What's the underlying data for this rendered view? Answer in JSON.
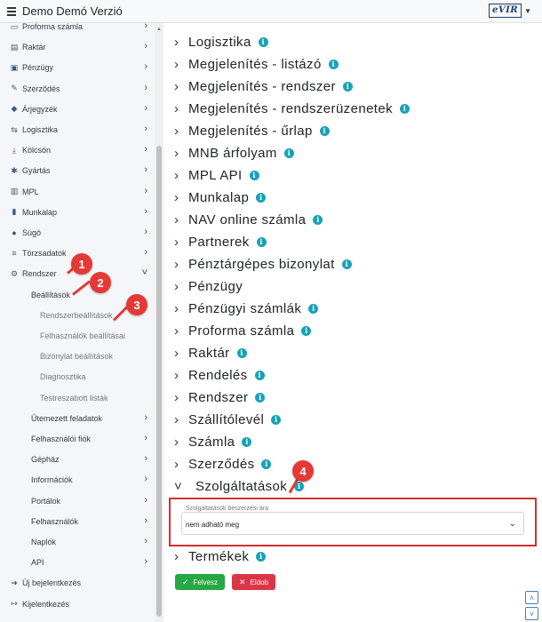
{
  "header": {
    "title": "Demo Demó Verzió",
    "logo_text": "eVIR"
  },
  "sidebar": {
    "items": [
      {
        "label": "Proforma számla",
        "icon": "invoice-icon",
        "chevron": "›"
      },
      {
        "label": "Raktár",
        "icon": "warehouse-icon",
        "chevron": "›"
      },
      {
        "label": "Pénzügy",
        "icon": "money-icon",
        "chevron": "›"
      },
      {
        "label": "Szerződés",
        "icon": "contract-icon",
        "chevron": "›"
      },
      {
        "label": "Árjegyzék",
        "icon": "tag-icon",
        "chevron": "›"
      },
      {
        "label": "Logisztika",
        "icon": "logistics-icon",
        "chevron": "›"
      },
      {
        "label": "Kölcsön",
        "icon": "loan-icon",
        "chevron": "›"
      },
      {
        "label": "Gyártás",
        "icon": "cogs-icon",
        "chevron": "›"
      },
      {
        "label": "MPL",
        "icon": "mpl-icon",
        "chevron": "›"
      },
      {
        "label": "Munkalap",
        "icon": "file-icon",
        "chevron": "›"
      },
      {
        "label": "Súgó",
        "icon": "help-icon",
        "chevron": "›"
      },
      {
        "label": "Törzsadatok",
        "icon": "database-icon",
        "chevron": "›"
      },
      {
        "label": "Rendszer",
        "icon": "settings-icon",
        "chevron": "˅"
      }
    ],
    "sub_items": [
      {
        "label": "Beállítások",
        "level": 1
      },
      {
        "label": "Rendszerbeállítások",
        "level": 2
      },
      {
        "label": "Felhasználók beállításai",
        "level": 2
      },
      {
        "label": "Bizonylat beállítások",
        "level": 2
      },
      {
        "label": "Diagnosztika",
        "level": 2
      },
      {
        "label": "Testreszabott listák",
        "level": 2
      },
      {
        "label": "Ütemezett feladatok",
        "level": 1,
        "chevron": "›"
      },
      {
        "label": "Felhasználói fiók",
        "level": 1,
        "chevron": "›"
      },
      {
        "label": "Gépház",
        "level": 1,
        "chevron": "›"
      },
      {
        "label": "Információk",
        "level": 1,
        "chevron": "›"
      },
      {
        "label": "Portálok",
        "level": 1,
        "chevron": "›"
      },
      {
        "label": "Felhasználók",
        "level": 1,
        "chevron": "›"
      },
      {
        "label": "Naplók",
        "level": 1,
        "chevron": "›"
      },
      {
        "label": "API",
        "level": 1,
        "chevron": "›"
      }
    ],
    "footer": [
      {
        "label": "Új bejelentkezés",
        "icon": "login-icon"
      },
      {
        "label": "Kijelentkezés",
        "icon": "logout-icon"
      }
    ]
  },
  "main": {
    "sections": [
      "Logisztika",
      "Megjelenítés - listázó",
      "Megjelenítés - rendszer",
      "Megjelenítés - rendszerüzenetek",
      "Megjelenítés - űrlap",
      "MNB árfolyam",
      "MPL API",
      "Munkalap",
      "NAV online számla",
      "Partnerek",
      "Pénztárgépes bizonylat",
      "Pénzügy",
      "Pénzügyi számlák",
      "Proforma számla",
      "Raktár",
      "Rendelés",
      "Rendszer",
      "Szállítólevél",
      "Számla",
      "Szerződés",
      "Szolgáltatások",
      "Termékek"
    ],
    "section_info": [
      true,
      true,
      true,
      true,
      true,
      true,
      true,
      true,
      true,
      true,
      true,
      false,
      true,
      true,
      true,
      true,
      true,
      true,
      true,
      true,
      true,
      true
    ],
    "expanded_section": "Szolgáltatások",
    "field": {
      "label": "Szolgáltatások beszerzési ára",
      "value": "nem adható meg"
    },
    "buttons": {
      "save": "Felvesz",
      "cancel": "Eldob"
    }
  },
  "badges": [
    "1",
    "2",
    "3",
    "4"
  ],
  "colors": {
    "accent_red": "#e53935",
    "info": "#17a2b8",
    "save_green": "#28a745",
    "cancel_red": "#dc3545"
  }
}
